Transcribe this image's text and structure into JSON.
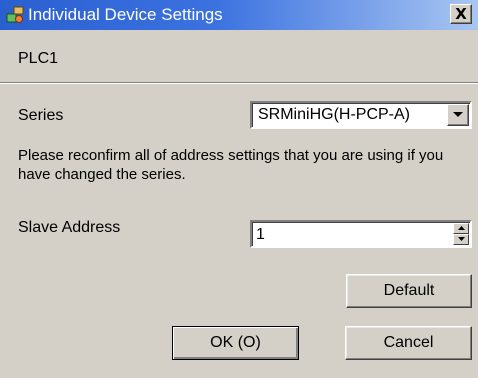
{
  "window": {
    "title": "Individual Device Settings",
    "app_icon": "device-settings-icon",
    "close_label": "X"
  },
  "plc_name": "PLC1",
  "series": {
    "label": "Series",
    "value": "SRMiniHG(H-PCP-A)"
  },
  "note": "Please reconfirm all of address settings that you are using if you have changed the series.",
  "slave_address": {
    "label": "Slave Address",
    "value": "1"
  },
  "buttons": {
    "default_label": "Default",
    "ok_label": "OK (O)",
    "cancel_label": "Cancel"
  }
}
